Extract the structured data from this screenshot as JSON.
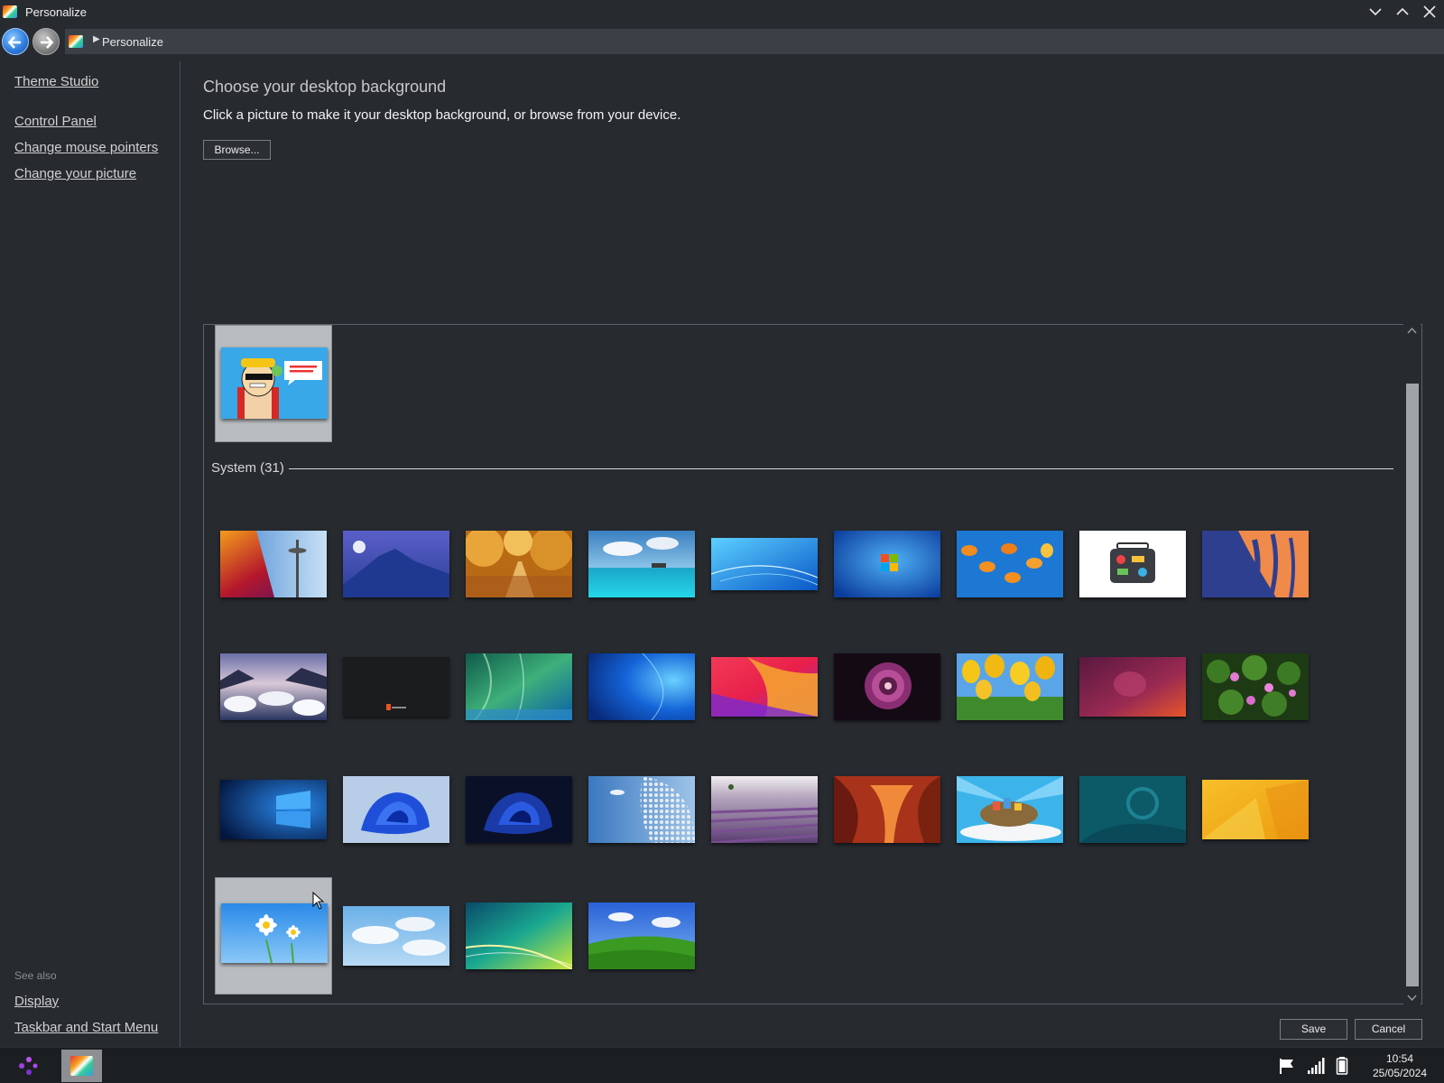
{
  "window": {
    "title": "Personalize"
  },
  "address": {
    "crumb": "Personalize"
  },
  "sidebar": {
    "links": [
      {
        "label": "Theme Studio"
      },
      {
        "label": "Control Panel"
      },
      {
        "label": "Change mouse pointers"
      },
      {
        "label": "Change your picture"
      }
    ],
    "see_also_label": "See also",
    "see_also_links": [
      {
        "label": "Display"
      },
      {
        "label": "Taskbar and Start Menu"
      }
    ]
  },
  "main": {
    "title": "Choose your desktop background",
    "description": "Click a picture to make it your desktop background, or browse from your device.",
    "browse_label": "Browse...",
    "group_label": "System (31)",
    "save_label": "Save",
    "cancel_label": "Cancel"
  },
  "taskbar": {
    "time": "10:54",
    "date": "25/05/2024"
  },
  "colors": {
    "background": "#272b30",
    "selected_tile": "#b9bdc1",
    "accent_blue": "#2f7fe0"
  }
}
